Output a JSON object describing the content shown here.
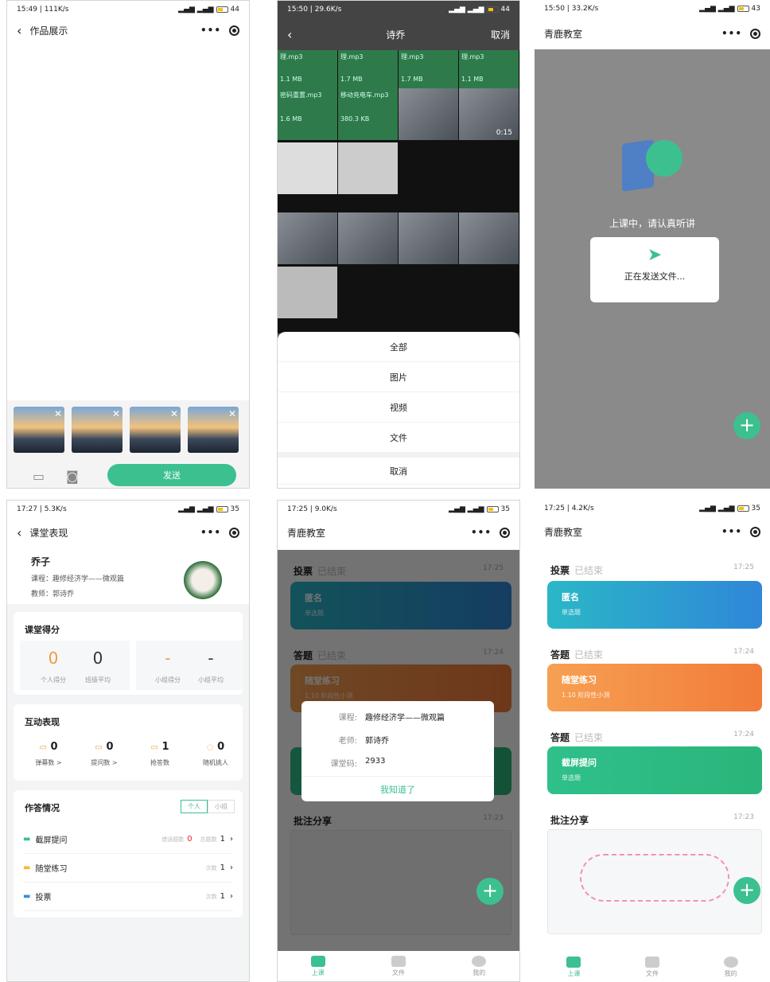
{
  "s1": {
    "status": {
      "time": "15:49 | 111K/s",
      "battery": "44"
    },
    "title": "作品展示",
    "send": "发送"
  },
  "s2": {
    "status": {
      "time": "15:50 | 29.6K/s",
      "battery": "44"
    },
    "title": "诗乔",
    "cancel_top": "取消",
    "files": [
      {
        "name": "理.mp3",
        "size": "1.1 MB"
      },
      {
        "name": "理.mp3",
        "size": "1.7 MB"
      },
      {
        "name": "理.mp3",
        "size": "1.7 MB"
      },
      {
        "name": "理.mp3",
        "size": "1.1 MB"
      },
      {
        "name": "密码重置.mp3",
        "size": "1.6 MB"
      },
      {
        "name": "移动充电车.mp3",
        "size": "380.3 KB"
      }
    ],
    "video_duration": "0:15",
    "sheet": [
      "全部",
      "图片",
      "视频",
      "文件",
      "取消"
    ]
  },
  "s3": {
    "status": {
      "time": "15:50 | 33.2K/s",
      "battery": "43"
    },
    "title": "青鹿教室",
    "listen": "上课中，请认真听讲",
    "sending": "正在发送文件..."
  },
  "s4": {
    "status": {
      "time": "17:27 | 5.3K/s",
      "battery": "35"
    },
    "title": "课堂表现",
    "name": "乔子",
    "course": "课程：趣修经济学——微观篇",
    "teacher": "教师：郭诗乔",
    "score_title": "课堂得分",
    "scores": [
      {
        "v": "0",
        "l": "个人得分"
      },
      {
        "v": "0",
        "l": "班级平均"
      },
      {
        "v": "-",
        "l": "小组得分"
      },
      {
        "v": "-",
        "l": "小组平均"
      }
    ],
    "inter_title": "互动表现",
    "inter": [
      {
        "v": "0",
        "l": "弹幕数 >"
      },
      {
        "v": "0",
        "l": "提问数 >"
      },
      {
        "v": "1",
        "l": "抢答数"
      },
      {
        "v": "0",
        "l": "随机挑人"
      }
    ],
    "hw_title": "作答情况",
    "seg": [
      "个人",
      "小组"
    ],
    "hw": [
      {
        "name": "截屏提问",
        "meta1": "错误题数",
        "v1": "0",
        "meta2": "总题数",
        "v2": "1"
      },
      {
        "name": "随堂练习",
        "meta2": "次数",
        "v2": "1"
      },
      {
        "name": "投票",
        "meta2": "次数",
        "v2": "1"
      }
    ]
  },
  "feed": {
    "title": "青鹿教室",
    "vote": "投票",
    "ended": "已结束",
    "t1": "17:25",
    "anon": "匿名",
    "single": "单选题",
    "answer": "答题",
    "t2": "17:24",
    "practice": "随堂练习",
    "practice_sub": "1.10 阶段性小测",
    "shot": "截屏提问",
    "t3": "17:24",
    "annot": "批注分享",
    "t4": "17:23",
    "tabs": [
      "上课",
      "文件",
      "我的"
    ]
  },
  "s5": {
    "status": {
      "time": "17:25 | 9.0K/s",
      "battery": "35"
    },
    "dialog": {
      "course_l": "课程:",
      "course": "趣修经济学——微观篇",
      "teacher_l": "老师:",
      "teacher": "郭诗乔",
      "code_l": "课堂码:",
      "code": "2933",
      "ok": "我知道了"
    }
  },
  "s6": {
    "status": {
      "time": "17:25 | 4.2K/s",
      "battery": "35"
    }
  }
}
